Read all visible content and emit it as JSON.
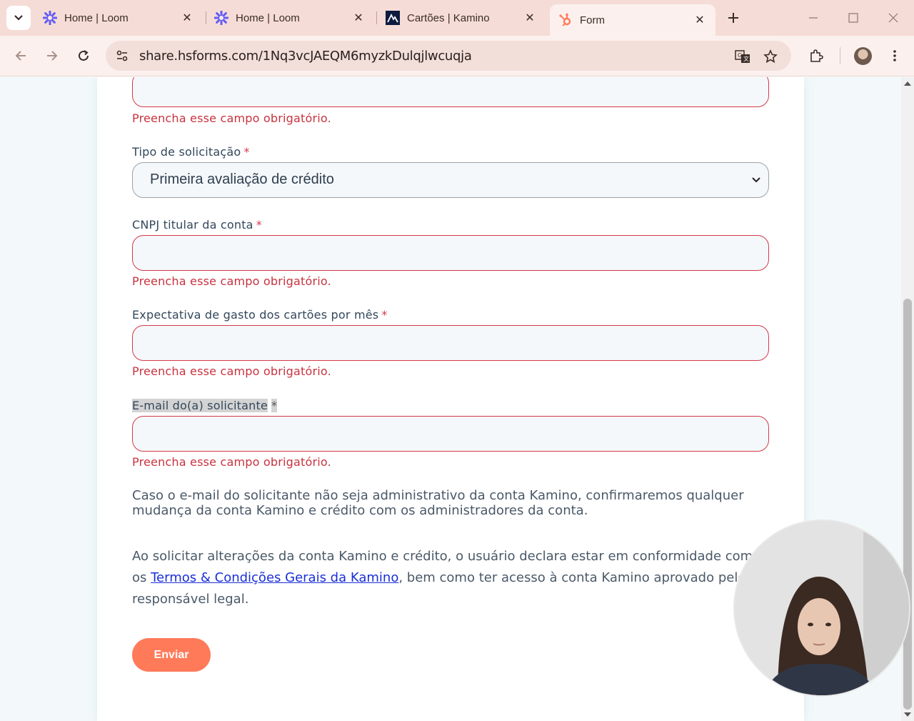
{
  "browser": {
    "tabs": [
      {
        "title": "Home | Loom",
        "icon": "loom-icon"
      },
      {
        "title": "Home | Loom",
        "icon": "loom-icon"
      },
      {
        "title": "Cartões | Kamino",
        "icon": "kamino-icon"
      },
      {
        "title": "Form",
        "icon": "hubspot-icon",
        "active": true
      }
    ],
    "url": "share.hsforms.com/1Nq3vcJAEQM6myzkDulqjlwcuqja"
  },
  "form": {
    "error_text": "Preencha esse campo obrigatório.",
    "required_mark": "*",
    "fields": {
      "tipo": {
        "label": "Tipo de solicitação",
        "value": "Primeira avaliação de crédito"
      },
      "cnpj": {
        "label": "CNPJ titular da conta"
      },
      "gasto": {
        "label": "Expectativa de gasto dos cartões por mês"
      },
      "email": {
        "label": "E-mail do(a) solicitante"
      }
    },
    "note": "Caso o e-mail do solicitante não seja administrativo da conta Kamino, confirmaremos qualquer mudança da conta Kamino e crédito com os administradores da conta.",
    "terms": {
      "before": "Ao solicitar alterações da conta Kamino e crédito, o usuário declara estar em conformidade com os ",
      "link": "Termos & Condições Gerais da Kamino",
      "after": ", bem como ter acesso à conta Kamino aprovado pelo responsável legal."
    },
    "submit_label": "Enviar"
  },
  "colors": {
    "error": "#d4394a",
    "submit": "#ff7a59",
    "tabbar": "#f6dcd6",
    "link": "#1a2fd6"
  }
}
